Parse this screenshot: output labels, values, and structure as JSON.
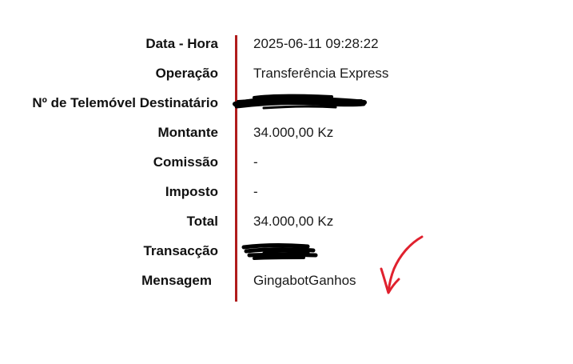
{
  "rows": [
    {
      "label": "Data - Hora",
      "value": "2025-06-11 09:28:22"
    },
    {
      "label": "Operação",
      "value": "Transferência Express"
    },
    {
      "label": "Nº de Telemóvel Destinatário",
      "value": ""
    },
    {
      "label": "Montante",
      "value": "34.000,00 Kz"
    },
    {
      "label": "Comissão",
      "value": "-"
    },
    {
      "label": "Imposto",
      "value": "-"
    },
    {
      "label": "Total",
      "value": "34.000,00 Kz"
    },
    {
      "label": "Transacção",
      "value": ""
    },
    {
      "label": "Mensagem",
      "value": "GingabotGanhos"
    }
  ],
  "colors": {
    "divider": "#b01c1c",
    "redaction": "#000000",
    "annotation_arrow": "#e0212e"
  },
  "icons": {
    "redaction": "redaction-scribble",
    "annotation": "red-arrow-annotation"
  }
}
